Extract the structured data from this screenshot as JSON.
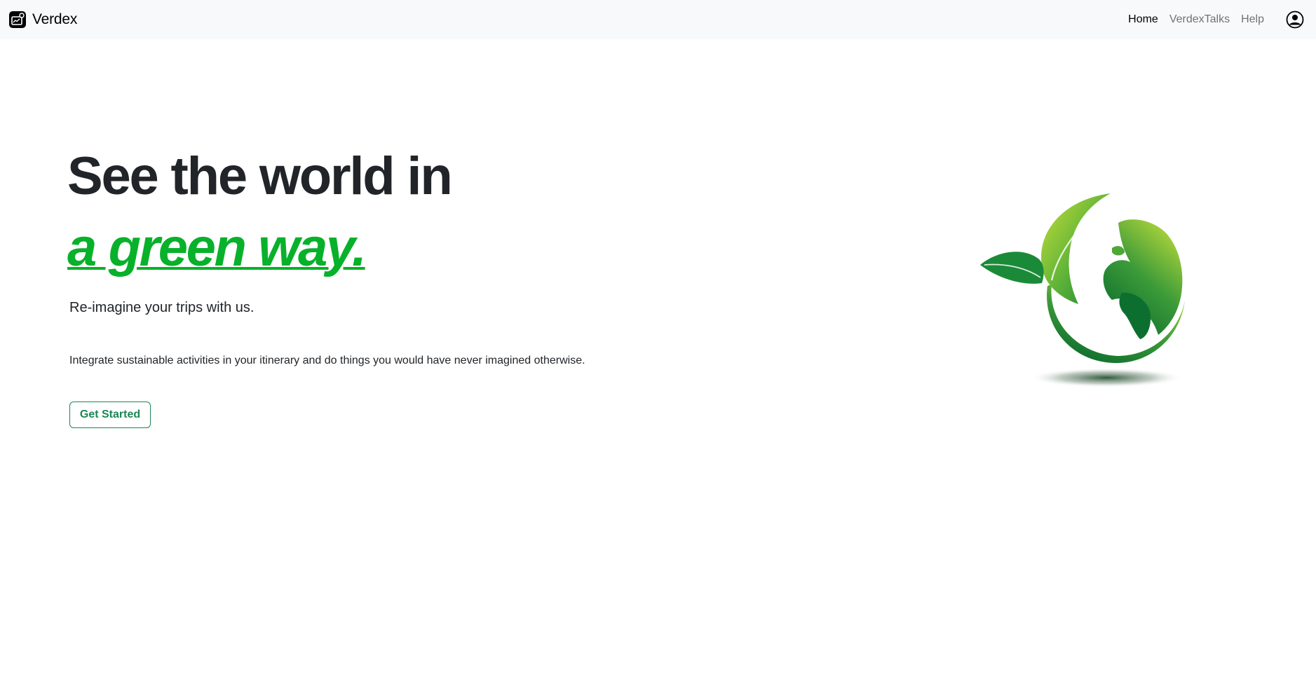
{
  "navbar": {
    "brand": "Verdex",
    "links": [
      {
        "label": "Home",
        "active": true
      },
      {
        "label": "VerdexTalks",
        "active": false
      },
      {
        "label": "Help",
        "active": false
      }
    ],
    "profile_icon": "person-circle-icon",
    "brand_icon": "ticket-icon"
  },
  "hero": {
    "title": "See the world in",
    "accent": "a green way.",
    "subtitle": "Re-imagine your trips with us.",
    "description": "Integrate sustainable activities in your itinerary and do things you would have never imagined otherwise.",
    "cta_label": "Get Started"
  },
  "colors": {
    "accent_green": "#08b12a",
    "button_green": "#198754",
    "navbar_bg": "#f8f9fa"
  }
}
